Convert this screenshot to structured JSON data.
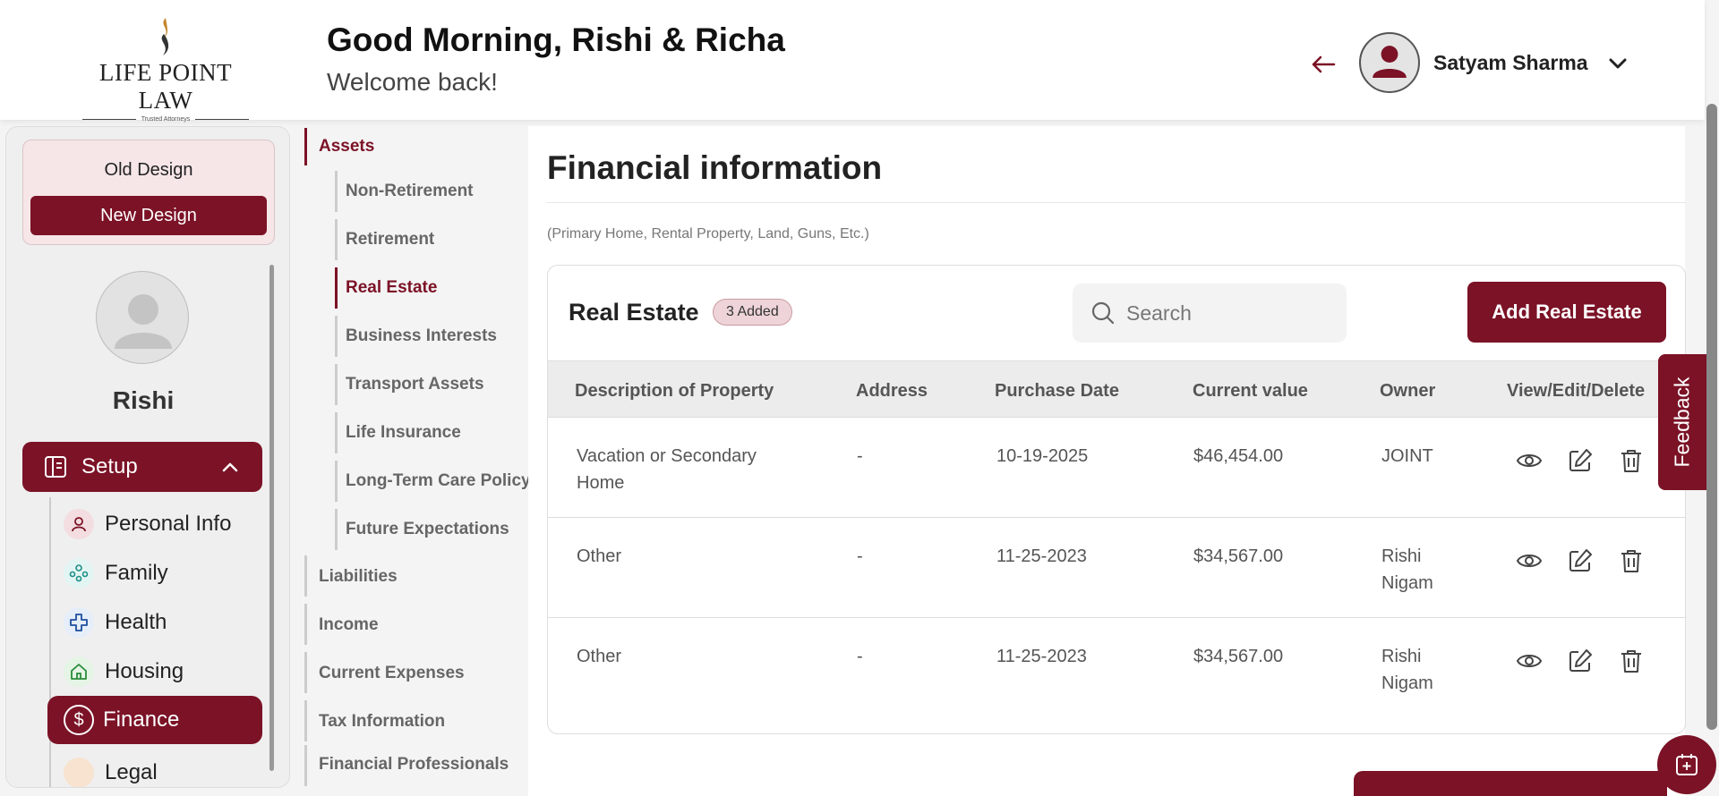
{
  "header": {
    "logo_text": "LIFE POINT LAW",
    "logo_tagline": "Trusted Attorneys",
    "greeting": "Good Morning, Rishi & Richa",
    "welcome": "Welcome back!",
    "user_name": "Satyam Sharma"
  },
  "sidebar": {
    "old_design": "Old Design",
    "new_design": "New Design",
    "profile_name": "Rishi",
    "setup_label": "Setup",
    "items": [
      {
        "label": "Personal Info"
      },
      {
        "label": "Family"
      },
      {
        "label": "Health"
      },
      {
        "label": "Housing"
      },
      {
        "label": "Finance"
      },
      {
        "label": "Legal"
      }
    ]
  },
  "secnav": {
    "top": [
      "Assets",
      "Liabilities",
      "Income",
      "Current Expenses",
      "Tax Information",
      "Financial Professionals"
    ],
    "assets_sub": [
      "Non-Retirement",
      "Retirement",
      "Real Estate",
      "Business Interests",
      "Transport Assets",
      "Life Insurance",
      "Long-Term Care Policy",
      "Future Expectations"
    ]
  },
  "main": {
    "title": "Financial information",
    "hint": "(Primary Home, Rental Property, Land, Guns, Etc.)",
    "card_title": "Real Estate",
    "badge": "3 Added",
    "search_placeholder": "Search",
    "add_button": "Add Real Estate",
    "columns": [
      "Description of Property",
      "Address",
      "Purchase Date",
      "Current value",
      "Owner",
      "View/Edit/Delete"
    ],
    "rows": [
      {
        "description": "Vacation or Secondary Home",
        "address": "-",
        "date": "10-19-2025",
        "value": "$46,454.00",
        "owner": "JOINT"
      },
      {
        "description": "Other",
        "address": "-",
        "date": "11-25-2023",
        "value": "$34,567.00",
        "owner": "Rishi Nigam"
      },
      {
        "description": "Other",
        "address": "-",
        "date": "11-25-2023",
        "value": "$34,567.00",
        "owner": "Rishi Nigam"
      }
    ]
  },
  "feedback_label": "Feedback",
  "colors": {
    "brand": "#7b1226",
    "badge_bg": "#eed4d8"
  }
}
